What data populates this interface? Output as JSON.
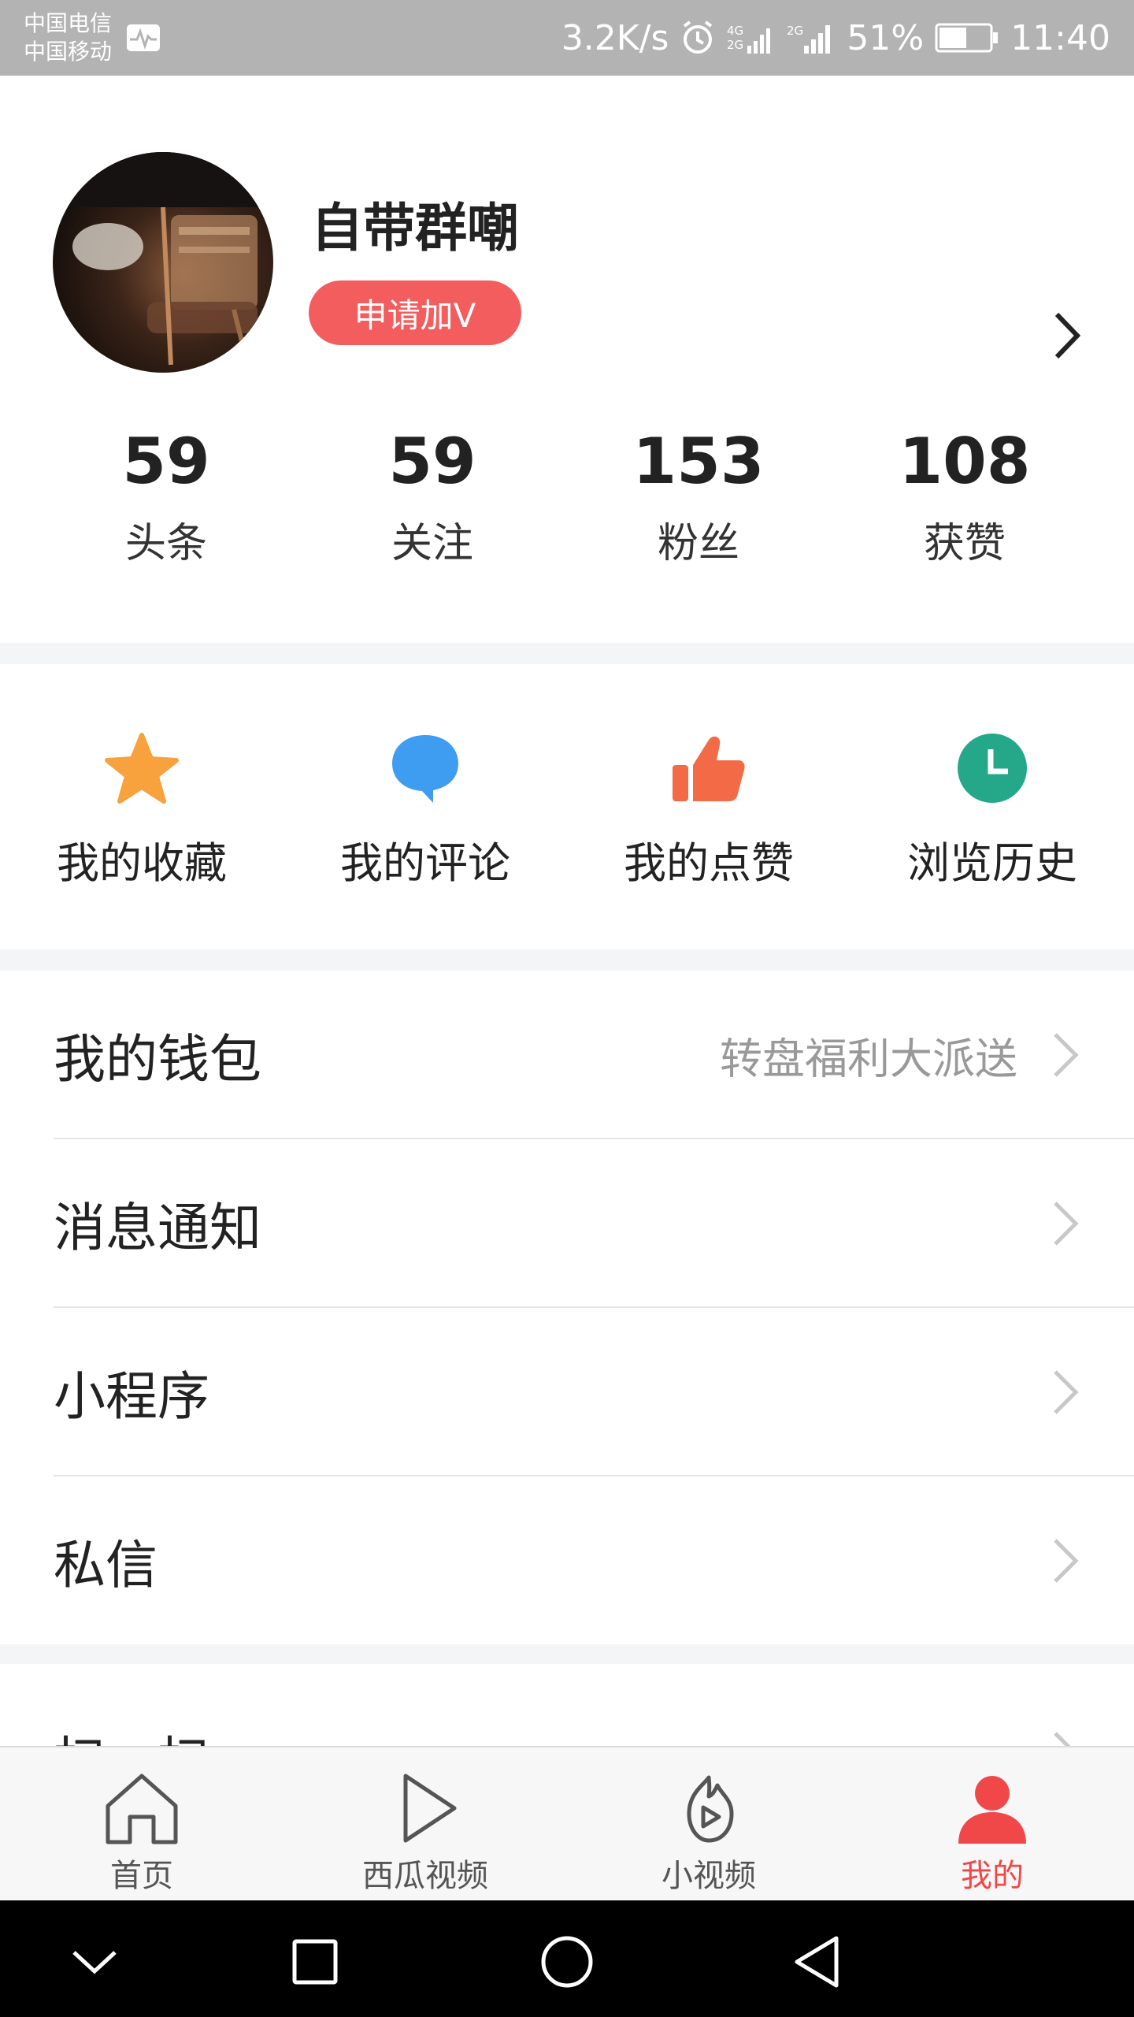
{
  "status_bar": {
    "carrier_1": "中国电信",
    "carrier_2": "中国移动",
    "net_speed": "3.2K/s",
    "battery": "51%",
    "time": "11:40"
  },
  "profile": {
    "name": "自带群嘲",
    "apply_v": "申请加V"
  },
  "stats": [
    {
      "value": "59",
      "label": "头条"
    },
    {
      "value": "59",
      "label": "关注"
    },
    {
      "value": "153",
      "label": "粉丝"
    },
    {
      "value": "108",
      "label": "获赞"
    }
  ],
  "quick_actions": [
    {
      "label": "我的收藏",
      "icon": "star-icon",
      "color": "#f7a23c"
    },
    {
      "label": "我的评论",
      "icon": "comment-icon",
      "color": "#3f9df1"
    },
    {
      "label": "我的点赞",
      "icon": "thumb-up-icon",
      "color": "#f36b46"
    },
    {
      "label": "浏览历史",
      "icon": "clock-icon",
      "color": "#25a88a"
    }
  ],
  "menu": [
    {
      "label": "我的钱包",
      "sub": "转盘福利大派送"
    },
    {
      "label": "消息通知"
    },
    {
      "label": "小程序"
    },
    {
      "label": "私信"
    }
  ],
  "menu2": {
    "label": "扫一扫"
  },
  "tabs": [
    {
      "label": "首页",
      "icon": "home-icon"
    },
    {
      "label": "西瓜视频",
      "icon": "play-icon"
    },
    {
      "label": "小视频",
      "icon": "flame-play-icon"
    },
    {
      "label": "我的",
      "icon": "user-icon",
      "active": true
    }
  ],
  "colors": {
    "accent": "#f04848",
    "apply_v_bg": "#f45d5d",
    "status_bar": "#b3b3b3"
  }
}
